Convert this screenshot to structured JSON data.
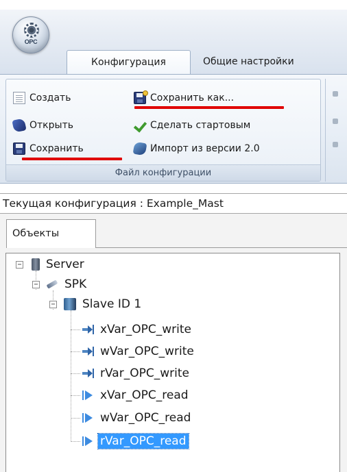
{
  "app": {
    "orb_text": "OPC",
    "tabs": [
      {
        "label": "Конфигурация",
        "active": true
      },
      {
        "label": "Общие настройки",
        "active": false
      }
    ]
  },
  "ribbon": {
    "group_label": "Файл конфигурации",
    "buttons": {
      "create": {
        "label": "Создать",
        "icon": "new-document-icon"
      },
      "open": {
        "label": "Открыть",
        "icon": "open-icon"
      },
      "save": {
        "label": "Сохранить",
        "icon": "floppy-disk-icon"
      },
      "save_as": {
        "label": "Сохранить как...",
        "icon": "save-as-icon"
      },
      "make_startup": {
        "label": "Сделать стартовым",
        "icon": "checkmark-icon"
      },
      "import": {
        "label": "Импорт из версии 2.0",
        "icon": "import-icon"
      }
    },
    "highlight_color": "#e00000"
  },
  "current_config": {
    "text": "Текущая конфигурация : Example_Mast"
  },
  "objects_panel": {
    "tab_label": "Объекты",
    "tree": {
      "server": {
        "label": "Server",
        "icon": "server-icon"
      },
      "spk": {
        "label": "SPK",
        "icon": "device-icon"
      },
      "slave": {
        "label": "Slave ID 1",
        "icon": "slave-device-icon"
      },
      "variables": [
        {
          "label": "xVar_OPC_write",
          "kind": "write"
        },
        {
          "label": "wVar_OPC_write",
          "kind": "write"
        },
        {
          "label": "rVar_OPC_write",
          "kind": "write"
        },
        {
          "label": "xVar_OPC_read",
          "kind": "read"
        },
        {
          "label": "wVar_OPC_read",
          "kind": "read"
        },
        {
          "label": "rVar_OPC_read",
          "kind": "read",
          "selected": true
        }
      ]
    },
    "selection_color": "#3399ff"
  }
}
